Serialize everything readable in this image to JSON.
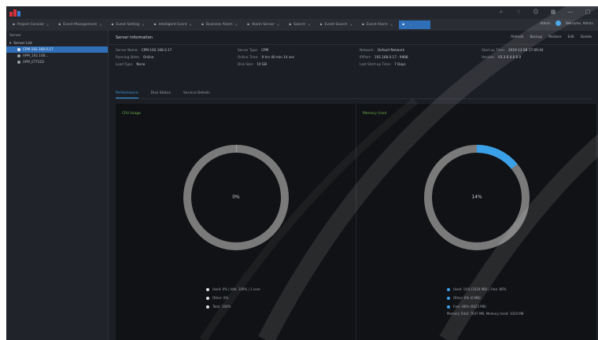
{
  "titlebar": {
    "window_controls": [
      "search-icon",
      "bell-icon",
      "user-icon",
      "grid-icon",
      "minimize-icon",
      "maximize-icon"
    ]
  },
  "tabs": [
    {
      "label": "Project Console",
      "active": false
    },
    {
      "label": "Event Management",
      "active": false
    },
    {
      "label": "Event Setting",
      "active": false
    },
    {
      "label": "Intelligent Event",
      "active": false
    },
    {
      "label": "Business Alarm",
      "active": false
    },
    {
      "label": "Alarm Server",
      "active": false
    },
    {
      "label": "Search",
      "active": false
    },
    {
      "label": "Event Search",
      "active": false
    },
    {
      "label": "Event Alarm",
      "active": false
    },
    {
      "label": "",
      "active": true
    }
  ],
  "tab_right": {
    "user_label": "Admin",
    "account_label": "Welcome, Admin"
  },
  "sidebar": {
    "title": "Server",
    "root_label": "Server List",
    "items": [
      {
        "label": "CPM-192.168.0.17",
        "selected": true
      },
      {
        "label": "APM_192.168...",
        "selected": false
      },
      {
        "label": "APM_ETTSD2",
        "selected": false
      }
    ]
  },
  "main": {
    "title": "Server Information",
    "actions": [
      "Refresh",
      "Backup",
      "Restore",
      "Edit",
      "Delete"
    ],
    "info": [
      {
        "key": "Server Name:",
        "value": "CPM-192.168.0.17"
      },
      {
        "key": "Server Type:",
        "value": "CPM"
      },
      {
        "key": "Network:",
        "value": "Default Network"
      },
      {
        "key": "Start-up Time:",
        "value": "2019-12-08 17:09:44"
      },
      {
        "key": "Running State:",
        "value": "Online"
      },
      {
        "key": "Online Time:",
        "value": "9 hrs 40 min 14 sec"
      },
      {
        "key": "IP/Port:",
        "value": "192.168.0.17 : 9988"
      },
      {
        "key": "Version:",
        "value": "V3.3.0.4.0.0.0"
      },
      {
        "key": "Load Type:",
        "value": "None"
      },
      {
        "key": "Disk Size:",
        "value": "10 GB"
      },
      {
        "key": "Last Start-up Time:",
        "value": "7 Days"
      }
    ],
    "subtabs": [
      {
        "label": "Performance",
        "active": true
      },
      {
        "label": "Disk Status",
        "active": false
      },
      {
        "label": "Service Details",
        "active": false
      }
    ]
  },
  "cpu_panel": {
    "title": "CPU Usage",
    "center_label": "0%",
    "usage_fraction": 0.003,
    "legend": [
      {
        "label": "Used: 0% | Idle: 100% | 1 core",
        "color": "#e0e0e0"
      },
      {
        "label": "Other: 0%",
        "color": "#e0e0e0"
      },
      {
        "label": "Total: 100%",
        "color": "#e0e0e0"
      }
    ]
  },
  "memory_panel": {
    "title": "Memory Used",
    "center_label": "14%",
    "usage_fraction": 0.14,
    "legend": [
      {
        "label": "Used: 14% (1024 MB) | Free: 86%",
        "color": "#3aa0e8"
      },
      {
        "label": "Other: 0% (0 MB)",
        "color": "#3aa0e8"
      },
      {
        "label": "Free: 86% (6623 MB)",
        "color": "#3aa0e8"
      }
    ],
    "summary": "Memory Total: 7647 MB, Memory Used: 1024 MB"
  },
  "colors": {
    "accent": "#3aa0e8",
    "selected": "#2f6fb8",
    "ring_base": "#7a7a7a",
    "panel_title": "#6fae4a"
  }
}
